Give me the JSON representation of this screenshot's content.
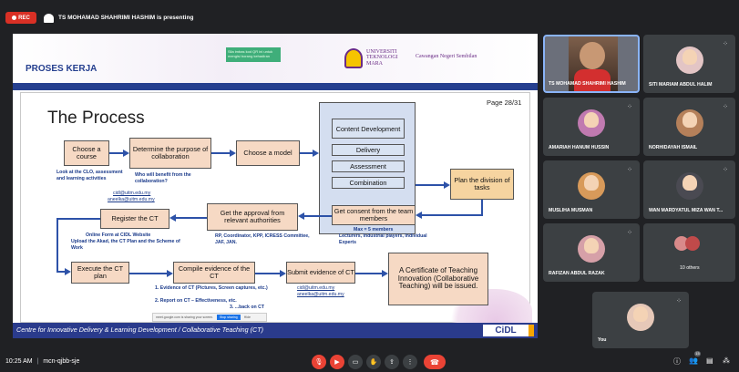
{
  "topbar": {
    "rec_label": "REC",
    "presenting_text": "TS MOHAMAD SHAHRIMI HASHIM is presenting"
  },
  "slide": {
    "header": {
      "title": "PROSES KERJA",
      "qr_text": "Sila imbas kod QR ini untuk mengisi borang kehadiran",
      "university": "UNIVERSITI TEKNOLOGI MARA",
      "campus": "Cawangan Negeri Sembilan"
    },
    "page_label": "Page 28/31",
    "heading": "The Process",
    "boxes": {
      "choose_course": "Choose a course",
      "purpose": "Determine the purpose of collaboration",
      "model": "Choose a model",
      "content_dev": "Content Development",
      "delivery": "Delivery",
      "assessment": "Assessment",
      "combination": "Combination",
      "plan_division": "Plan the division of tasks",
      "consent": "Get consent from the team members",
      "approval": "Get the approval from relevant authorities",
      "register": "Register the CT",
      "execute": "Execute the CT plan",
      "compile": "Compile evidence of the CT",
      "submit": "Submit evidence of CT",
      "certificate": "A Certificate of Teaching Innovation (Collaborative Teaching) will be issued."
    },
    "notes": {
      "clo": "Look at the CLO, assessment and learning activities",
      "benefit": "Who will benefit from the collaboration?",
      "email1": "cidl@uitm.edu.my",
      "email2": "aneelka@uitm.edu.my",
      "consent_max": "Max = 5 members",
      "team": "Lecturers, Industrial players, Individual Experts",
      "approval_list": "RP, Coordinator, KPP, ICRESS Committee, JAF, JAN.",
      "online_form": "Online Form at CIDL Website",
      "upload": "Upload the Akad, the CT Plan and the Scheme of Work",
      "submit_email1": "cidl@uitm.edu.my",
      "submit_email2": "aneelka@uitm.edu.my",
      "evidence_1": "1.   Evidence of CT (Pictures, Screen captures, etc.)",
      "evidence_2": "2.   Report on CT – Effectiveness, etc.",
      "evidence_3": "3.   ...back on CT"
    },
    "toast": {
      "text": "meet.google.com is sharing your screen.",
      "stop": "Stop sharing",
      "hide": "Hide"
    },
    "footer": "Centre for Innovative Delivery & Learning Development / Collaborative Teaching (CT)",
    "footer_logo": "CiDL"
  },
  "participants": [
    {
      "name": "TS MOHAMAD SHAHRIMI HASHIM"
    },
    {
      "name": "SITI MARIAM ABDUL HALIM"
    },
    {
      "name": "AMARIAH HANUM HUSSIN"
    },
    {
      "name": "NORHIDAYAH ISMAIL"
    },
    {
      "name": "MUSLIHA MUSMAN"
    },
    {
      "name": "WAN MARDYATUL MIZA WAN T..."
    },
    {
      "name": "RAFIZAN ABDUL RAZAK"
    },
    {
      "name": "10 others"
    },
    {
      "name": "You"
    }
  ],
  "bottombar": {
    "time": "10:25 AM",
    "separator": "|",
    "meeting_code": "mcn-qjbb-sje",
    "people_count": "15"
  },
  "colors": {
    "accent_red": "#ea4335",
    "slide_blue": "#253f8f"
  }
}
